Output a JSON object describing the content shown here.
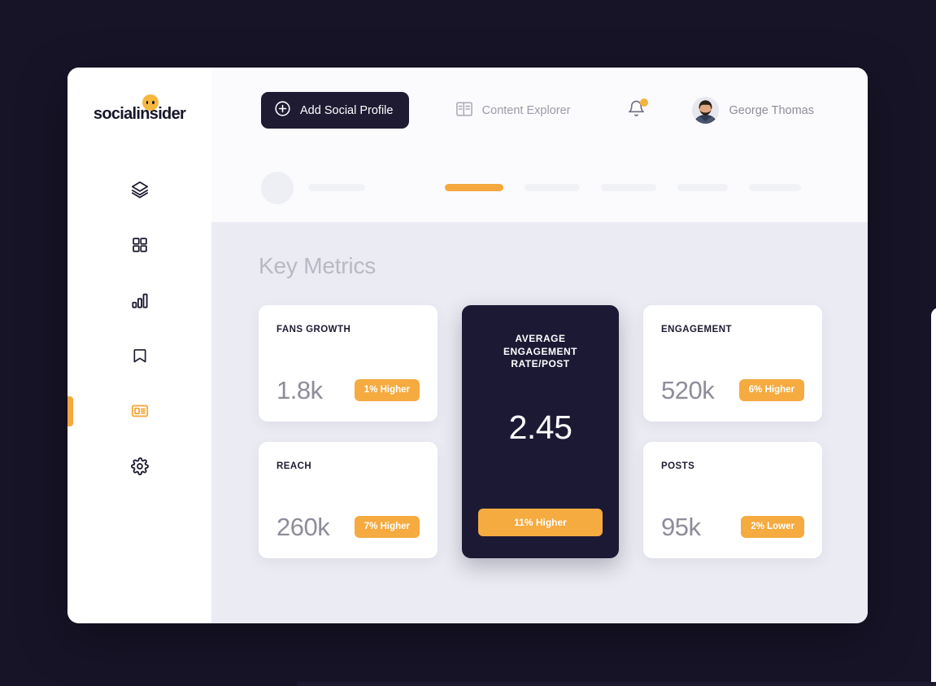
{
  "brand": {
    "logo_text": "socialinsider",
    "accent_color": "#F5A83D",
    "dark_color": "#1C1935",
    "page_bg": "#171428",
    "content_bg": "#EBEBF3"
  },
  "sidebar": {
    "items": [
      {
        "icon": "layers-icon",
        "name": "sidebar-item-layers",
        "active": false
      },
      {
        "icon": "grid-icon",
        "name": "sidebar-item-dashboard",
        "active": false
      },
      {
        "icon": "bar-chart-icon",
        "name": "sidebar-item-analytics",
        "active": false
      },
      {
        "icon": "bookmark-icon",
        "name": "sidebar-item-saved",
        "active": false
      },
      {
        "icon": "news-card-icon",
        "name": "sidebar-item-reports",
        "active": true
      },
      {
        "icon": "gear-icon",
        "name": "sidebar-item-settings",
        "active": false
      }
    ]
  },
  "topbar": {
    "add_profile_label": "Add Social Profile",
    "content_explorer_label": "Content Explorer",
    "notifications_badge": true,
    "user_name": "George Thomas"
  },
  "tabs_skeleton": {
    "tab_widths": [
      72,
      68,
      68,
      62,
      64
    ],
    "active_index": 0
  },
  "main": {
    "title": "Key Metrics",
    "cards": [
      {
        "label": "FANS GROWTH",
        "value": "1.8k",
        "delta": "1% Higher",
        "name": "metric-card-fans-growth",
        "highlight": false
      },
      {
        "label": "AVERAGE ENGAGEMENT RATE/POST",
        "value": "2.45",
        "delta": "11% Higher",
        "name": "metric-card-average-engagement-rate-per-post",
        "highlight": true
      },
      {
        "label": "ENGAGEMENT",
        "value": "520k",
        "delta": "6% Higher",
        "name": "metric-card-engagement",
        "highlight": false
      },
      {
        "label": "REACH",
        "value": "260k",
        "delta": "7% Higher",
        "name": "metric-card-reach",
        "highlight": false
      },
      {
        "label": "POSTS",
        "value": "95k",
        "delta": "2% Lower",
        "name": "metric-card-posts",
        "highlight": false
      }
    ]
  }
}
